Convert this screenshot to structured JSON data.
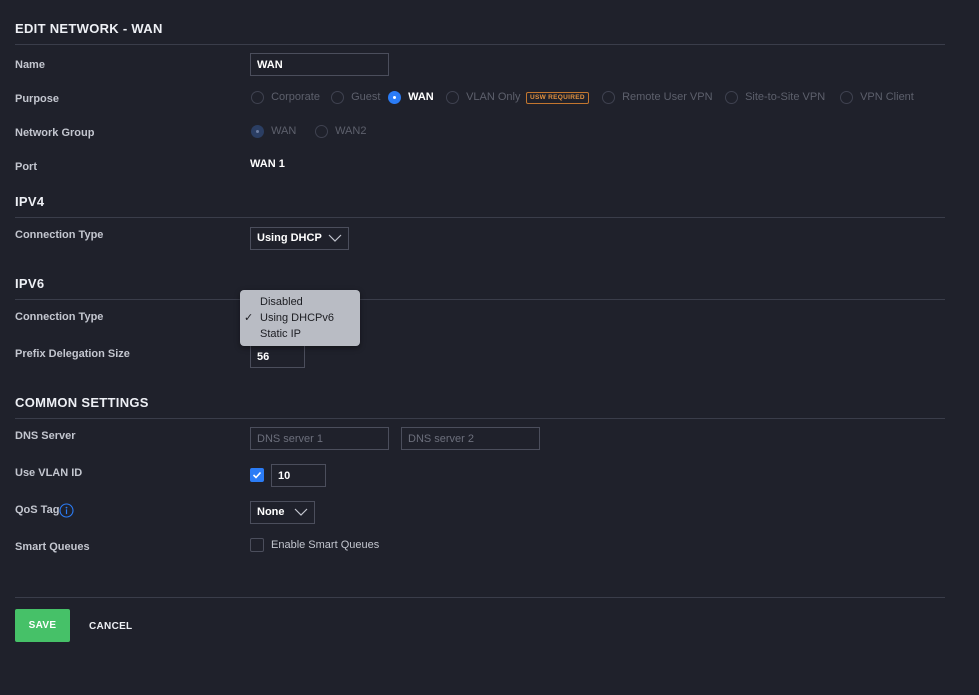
{
  "page": {
    "title": "EDIT NETWORK - WAN"
  },
  "name": {
    "label": "Name",
    "value": "WAN"
  },
  "purpose": {
    "label": "Purpose",
    "options": [
      "Corporate",
      "Guest",
      "WAN",
      "VLAN Only",
      "Remote User VPN",
      "Site-to-Site VPN",
      "VPN Client"
    ],
    "selected": "WAN",
    "badge": "USW REQUIRED"
  },
  "network_group": {
    "label": "Network Group",
    "options": [
      "WAN",
      "WAN2"
    ],
    "selected": "WAN"
  },
  "port": {
    "label": "Port",
    "value": "WAN 1"
  },
  "ipv4": {
    "heading": "IPV4",
    "connection_type_label": "Connection Type",
    "connection_type_value": "Using DHCP"
  },
  "ipv6": {
    "heading": "IPV6",
    "connection_type_label": "Connection Type",
    "dropdown_options": [
      "Disabled",
      "Using DHCPv6",
      "Static IP"
    ],
    "dropdown_selected": "Using DHCPv6",
    "prefix_label": "Prefix Delegation Size",
    "prefix_value": "56"
  },
  "common": {
    "heading": "COMMON SETTINGS",
    "dns_label": "DNS Server",
    "dns1_placeholder": "DNS server 1",
    "dns2_placeholder": "DNS server 2",
    "vlan_label": "Use VLAN ID",
    "vlan_checked": true,
    "vlan_value": "10",
    "qos_label": "QoS Tag",
    "qos_value": "None",
    "smart_label": "Smart Queues",
    "smart_checkbox_label": "Enable Smart Queues",
    "smart_checked": false
  },
  "actions": {
    "save": "SAVE",
    "cancel": "CANCEL"
  },
  "colors": {
    "background": "#1f212b",
    "accent": "#2b7cf6",
    "save": "#46c168",
    "badge": "#e0903e",
    "menu": "#b9bcc4"
  }
}
